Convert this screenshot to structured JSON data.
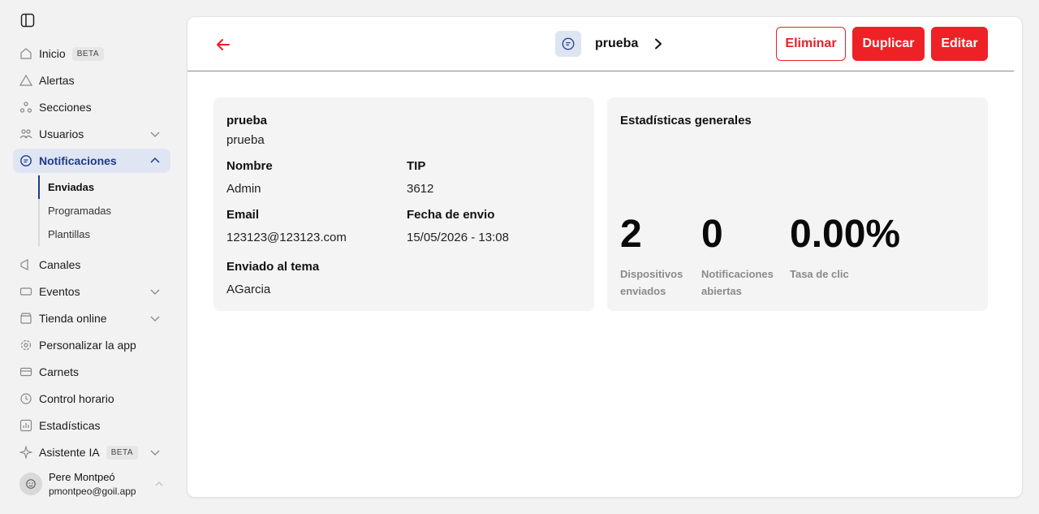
{
  "sidebar": {
    "items": [
      {
        "label": "Inicio",
        "badge": "BETA",
        "icon": "home-icon"
      },
      {
        "label": "Alertas",
        "icon": "alert-icon"
      },
      {
        "label": "Secciones",
        "icon": "sections-icon"
      },
      {
        "label": "Usuarios",
        "icon": "users-icon"
      },
      {
        "label": "Notificaciones",
        "icon": "chat-icon"
      },
      {
        "label": "Canales",
        "icon": "megaphone-icon"
      },
      {
        "label": "Eventos",
        "icon": "ticket-icon"
      },
      {
        "label": "Tienda online",
        "icon": "store-icon"
      },
      {
        "label": "Personalizar la app",
        "icon": "gear-icon"
      },
      {
        "label": "Carnets",
        "icon": "card-icon"
      },
      {
        "label": "Control horario",
        "icon": "clock-icon"
      },
      {
        "label": "Estadísticas",
        "icon": "chart-icon"
      },
      {
        "label": "Asistente IA",
        "badge": "BETA",
        "icon": "sparkle-icon"
      }
    ],
    "subitems": [
      {
        "label": "Enviadas"
      },
      {
        "label": "Programadas"
      },
      {
        "label": "Plantillas"
      }
    ],
    "user": {
      "name": "Pere Montpeó",
      "email": "pmontpeo@goil.app"
    }
  },
  "header": {
    "title": "prueba",
    "delete_label": "Eliminar",
    "duplicate_label": "Duplicar",
    "edit_label": "Editar"
  },
  "details": {
    "title": "prueba",
    "subtitle": "prueba",
    "name_label": "Nombre",
    "name_value": "Admin",
    "tip_label": "TIP",
    "tip_value": "3612",
    "email_label": "Email",
    "email_value": "123123@123123.com",
    "date_label": "Fecha de envio",
    "date_value": "15/05/2026 - 13:08",
    "topic_label": "Enviado al tema",
    "topic_value": "AGarcia"
  },
  "stats": {
    "title": "Estadísticas generales",
    "devices_value": "2",
    "devices_label_1": "Dispositivos",
    "devices_label_2": "enviados",
    "opened_value": "0",
    "opened_label_1": "Notificaciones",
    "opened_label_2": "abiertas",
    "ctr_value": "0.00%",
    "ctr_label": "Tasa de clic"
  },
  "colors": {
    "accent": "#ee2126",
    "active_nav": "#1e3a8a"
  }
}
